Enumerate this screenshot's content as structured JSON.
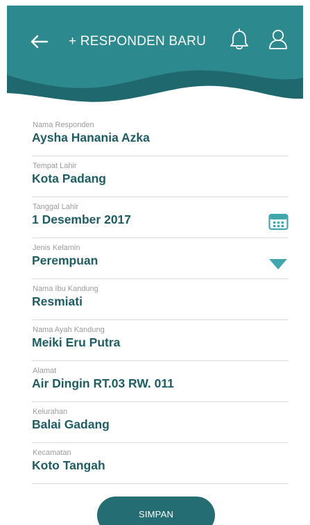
{
  "header": {
    "title": "+ RESPONDEN BARU",
    "back_icon": "back-arrow-icon",
    "notification_icon": "bell-icon",
    "profile_icon": "user-icon",
    "background_color": "#2c8a8f",
    "wave_color": "#1f686e"
  },
  "form": {
    "fields": [
      {
        "label": "Nama Responden",
        "value": "Aysha Hanania Azka"
      },
      {
        "label": "Tempat Lahir",
        "value": "Kota Padang"
      },
      {
        "label": "Tanggal Lahir",
        "value": "1 Desember 2017",
        "icon": "calendar-icon"
      },
      {
        "label": "Jenis Kelamin",
        "value": "Perempuan",
        "icon": "chevron-down-icon"
      },
      {
        "label": "Nama Ibu Kandung",
        "value": "Resmiati"
      },
      {
        "label": "Nama Ayah Kandung",
        "value": "Meiki Eru Putra"
      },
      {
        "label": "Alamat",
        "value": "Air Dingin RT.03 RW. 011"
      },
      {
        "label": "Kelurahan",
        "value": "Balai Gadang"
      },
      {
        "label": "Kecamatan",
        "value": "Koto Tangah"
      }
    ],
    "label_color": "#9b9b9b",
    "value_color": "#1d5d63",
    "accent_color": "#40a8ad"
  },
  "actions": {
    "save_label": "SIMPAN",
    "save_button_color": "#236d73"
  }
}
